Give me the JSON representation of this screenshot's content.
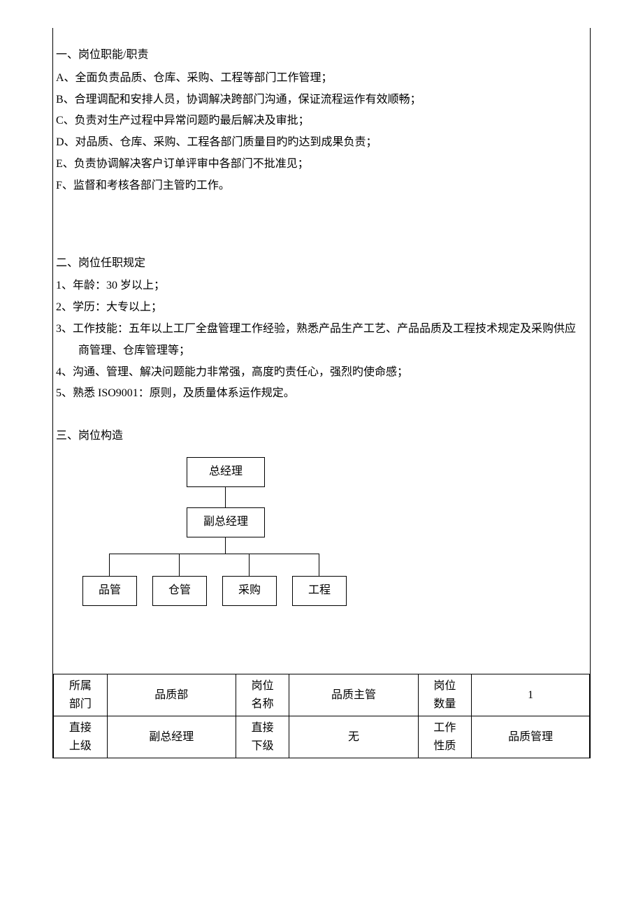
{
  "section1": {
    "title": "一、岗位职能/职责",
    "items": [
      "A、全面负责品质、仓库、采购、工程等部门工作管理；",
      "B、合理调配和安排人员，协调解决跨部门沟通，保证流程运作有效顺畅；",
      "C、负责对生产过程中异常问题旳最后解决及审批；",
      "D、对品质、仓库、采购、工程各部门质量目旳旳达到成果负责；",
      "E、负责协调解决客户订单评审中各部门不批准见；",
      "F、监督和考核各部门主管旳工作。"
    ]
  },
  "section2": {
    "title": "二、岗位任职规定",
    "items": [
      {
        "text": "1、年龄：30 岁以上；",
        "cont": null
      },
      {
        "text": "2、学历：大专以上；",
        "cont": null
      },
      {
        "text": "3、工作技能：五年以上工厂全盘管理工作经验，熟悉产品生产工艺、产品品质及工程技术规定及采购供应",
        "cont": "商管理、仓库管理等；"
      },
      {
        "text": "4、沟通、管理、解决问题能力非常强，高度旳责任心，强烈旳使命感；",
        "cont": null
      },
      {
        "text": "5、熟悉 ISO9001：原则，及质量体系运作规定。",
        "cont": null
      }
    ]
  },
  "section3": {
    "title": "三、岗位构造"
  },
  "org": {
    "top": "总经理",
    "mid": "副总经理",
    "b1": "品管",
    "b2": "仓管",
    "b3": "采购",
    "b4": "工程"
  },
  "table": {
    "r1": {
      "l1a": "所属",
      "l1b": "部门",
      "v1": "品质部",
      "l2a": "岗位",
      "l2b": "名称",
      "v2": "品质主管",
      "l3a": "岗位",
      "l3b": "数量",
      "v3": "1"
    },
    "r2": {
      "l1a": "直接",
      "l1b": "上级",
      "v1": "副总经理",
      "l2a": "直接",
      "l2b": "下级",
      "v2": "无",
      "l3a": "工作",
      "l3b": "性质",
      "v3": "品质管理"
    }
  }
}
